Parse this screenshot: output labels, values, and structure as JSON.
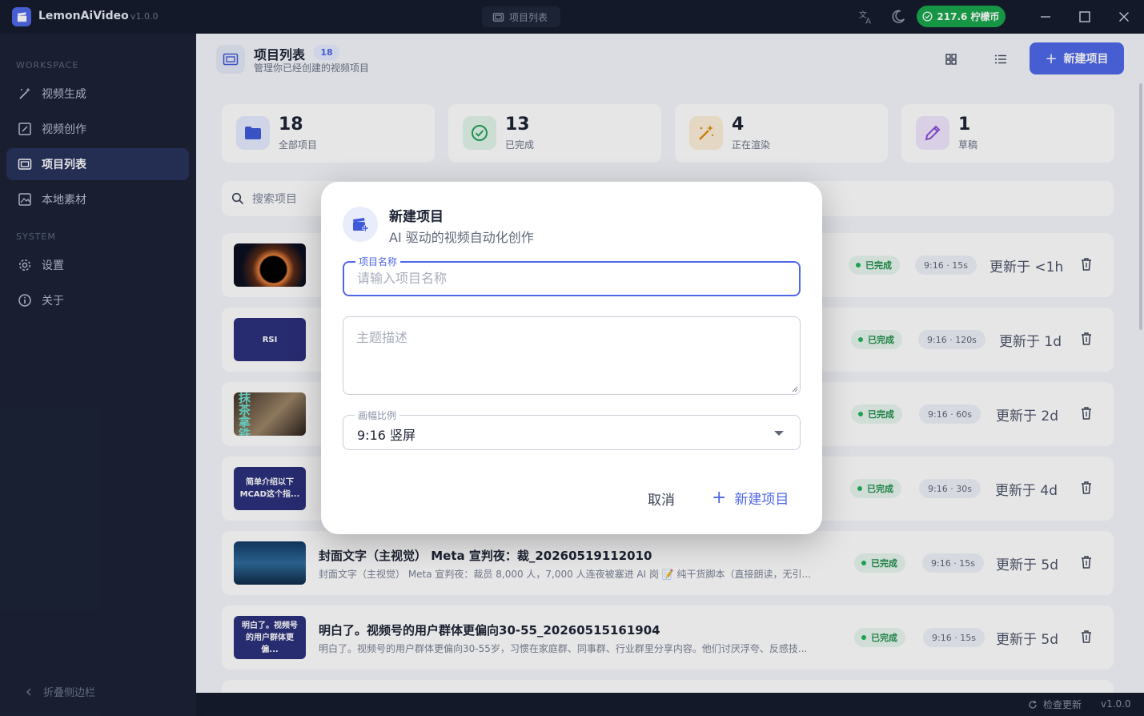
{
  "app": {
    "name": "LemonAiVideo",
    "version": "v1.0.0",
    "window_tab": "项目列表",
    "coins": "217.6 柠檬币"
  },
  "sidebar": {
    "workspace_label": "WORKSPACE",
    "system_label": "SYSTEM",
    "workspace_items": [
      {
        "label": "视频生成",
        "icon": "magic-wand-icon"
      },
      {
        "label": "视频创作",
        "icon": "edit-square-icon"
      },
      {
        "label": "项目列表",
        "icon": "folder-icon",
        "active": true
      },
      {
        "label": "本地素材",
        "icon": "image-icon"
      }
    ],
    "system_items": [
      {
        "label": "设置",
        "icon": "gear-icon"
      },
      {
        "label": "关于",
        "icon": "info-icon"
      }
    ],
    "collapse_label": "折叠侧边栏"
  },
  "header": {
    "title": "项目列表",
    "count": "18",
    "subtitle": "管理你已经创建的视频项目",
    "new_button": "新建项目"
  },
  "stats": [
    {
      "value": "18",
      "label": "全部项目",
      "icon": "folder-icon",
      "color": "#3f5bd9",
      "bg": "#e6ebff"
    },
    {
      "value": "13",
      "label": "已完成",
      "icon": "check-circle-icon",
      "color": "#22a35a",
      "bg": "#e3f5ea"
    },
    {
      "value": "4",
      "label": "正在渲染",
      "icon": "magic-wand-icon",
      "color": "#e08a10",
      "bg": "#fdf0d9"
    },
    {
      "value": "1",
      "label": "草稿",
      "icon": "pencil-icon",
      "color": "#8a4fd8",
      "bg": "#f1e7fd"
    }
  ],
  "search": {
    "placeholder": "搜索项目"
  },
  "projects": [
    {
      "title": "",
      "desc": "",
      "status": "已完成",
      "meta": "9:16 · 15s",
      "updated": "更新于 <1h",
      "thumb_text": ""
    },
    {
      "title": "",
      "desc": "",
      "status": "已完成",
      "meta": "9:16 · 120s",
      "updated": "更新于 1d",
      "thumb_text": "RSI"
    },
    {
      "title": "",
      "desc": "",
      "status": "已完成",
      "meta": "9:16 · 60s",
      "updated": "更新于 2d",
      "thumb_text": "抹茶拿铁"
    },
    {
      "title": "",
      "desc": "",
      "status": "已完成",
      "meta": "9:16 · 30s",
      "updated": "更新于 4d",
      "thumb_text": "简单介绍以下MCAD这个指..."
    },
    {
      "title": "封面文字（主视觉） Meta 宣判夜：裁_20260519112010",
      "desc": "封面文字（主视觉） Meta 宣判夜：裁员 8,000 人，7,000 人连夜被塞进 AI 岗 📝 纯干货脚本（直接朗读，无引...",
      "status": "已完成",
      "meta": "9:16 · 15s",
      "updated": "更新于 5d",
      "thumb_text": ""
    },
    {
      "title": "明白了。视频号的用户群体更偏向30-55_20260515161904",
      "desc": "明白了。视频号的用户群体更偏向30-55岁，习惯在家庭群、同事群、行业群里分享内容。他们讨厌浮夸、反感技...",
      "status": "已完成",
      "meta": "9:16 · 15s",
      "updated": "更新于 5d",
      "thumb_text": "明白了。视频号的用户群体更偏..."
    }
  ],
  "footer": {
    "check_update": "检查更新",
    "version": "v1.0.0"
  },
  "dialog": {
    "title": "新建项目",
    "subtitle": "AI 驱动的视频自动化创作",
    "name_label": "项目名称",
    "name_placeholder": "请输入项目名称",
    "desc_placeholder": "主题描述",
    "ratio_label": "画幅比例",
    "ratio_value": "9:16 竖屏",
    "cancel": "取消",
    "create": "新建项目"
  }
}
